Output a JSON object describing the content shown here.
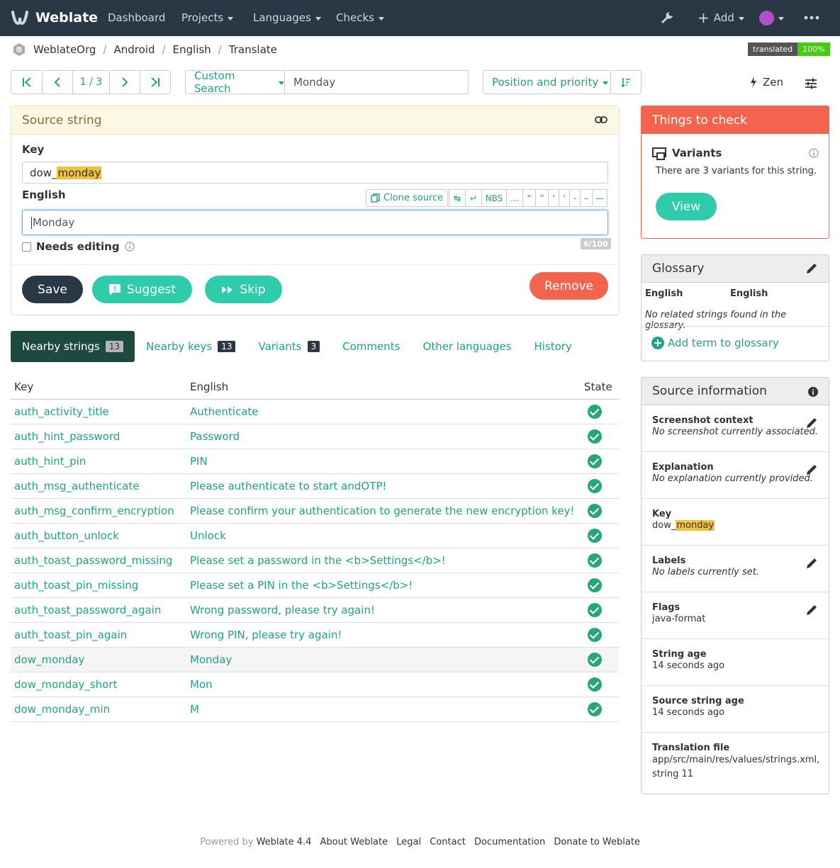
{
  "navbar": {
    "brand": "Weblate",
    "items": [
      "Dashboard",
      "Projects",
      "Languages",
      "Checks"
    ],
    "add_label": "Add",
    "bg_color": "#2a3744"
  },
  "breadcrumb": [
    "WeblateOrg",
    "Android",
    "English",
    "Translate"
  ],
  "status_badge": {
    "label": "translated",
    "value": "100%"
  },
  "pager": {
    "position": "1 / 3"
  },
  "search": {
    "mode": "Custom Search",
    "query": "Monday"
  },
  "sort": {
    "label": "Position and priority"
  },
  "zen_label": "Zen",
  "source_panel": {
    "title": "Source string",
    "key_label": "Key",
    "key_prefix": "dow_",
    "key_highlight": "monday",
    "lang_label": "English",
    "clone_label": "Clone source",
    "special_chars": [
      "↹",
      "↵",
      "NBS",
      "…",
      "“",
      "”",
      "‘",
      "’",
      "-",
      "–",
      "—"
    ],
    "text": "Monday",
    "needs_editing": "Needs editing",
    "counter": "6/100",
    "buttons": {
      "save": "Save",
      "suggest": "Suggest",
      "skip": "Skip",
      "remove": "Remove"
    }
  },
  "tabs": [
    {
      "label": "Nearby strings",
      "count": "13"
    },
    {
      "label": "Nearby keys",
      "count": "13"
    },
    {
      "label": "Variants",
      "count": "3"
    },
    {
      "label": "Comments",
      "count": ""
    },
    {
      "label": "Other languages",
      "count": ""
    },
    {
      "label": "History",
      "count": ""
    }
  ],
  "table": {
    "headers": [
      "Key",
      "English",
      "State"
    ],
    "rows": [
      {
        "key": "auth_activity_title",
        "text": "Authenticate"
      },
      {
        "key": "auth_hint_password",
        "text": "Password"
      },
      {
        "key": "auth_hint_pin",
        "text": "PIN"
      },
      {
        "key": "auth_msg_authenticate",
        "text": "Please authenticate to start andOTP!"
      },
      {
        "key": "auth_msg_confirm_encryption",
        "text": "Please confirm your authentication to generate the new encryption key!"
      },
      {
        "key": "auth_button_unlock",
        "text": "Unlock"
      },
      {
        "key": "auth_toast_password_missing",
        "text": "Please set a password in the <b>Settings</b>!"
      },
      {
        "key": "auth_toast_pin_missing",
        "text": "Please set a PIN in the <b>Settings</b>!"
      },
      {
        "key": "auth_toast_password_again",
        "text": "Wrong password, please try again!"
      },
      {
        "key": "auth_toast_pin_again",
        "text": "Wrong PIN, please try again!"
      },
      {
        "key": "dow_monday",
        "text": "Monday"
      },
      {
        "key": "dow_monday_short",
        "text": "Mon"
      },
      {
        "key": "dow_monday_min",
        "text": "M"
      }
    ]
  },
  "checks": {
    "title": "Things to check",
    "name": "Variants",
    "desc": "There are 3 variants for this string.",
    "view": "View"
  },
  "glossary": {
    "title": "Glossary",
    "col1": "English",
    "col2": "English",
    "empty": "No related strings found in the glossary.",
    "add": "Add term to glossary"
  },
  "source_info": {
    "title": "Source information",
    "screenshot_t": "Screenshot context",
    "screenshot_v": "No screenshot currently associated.",
    "explanation_t": "Explanation",
    "explanation_v": "No explanation currently provided.",
    "key_t": "Key",
    "key_prefix": "dow_",
    "key_highlight": "monday",
    "labels_t": "Labels",
    "labels_v": "No labels currently set.",
    "flags_t": "Flags",
    "flags_v": "java-format",
    "age_t": "String age",
    "age_v": "14 seconds ago",
    "src_age_t": "Source string age",
    "src_age_v": "14 seconds ago",
    "file_t": "Translation file",
    "file_v1": "app/src/main/res/values/strings.xml,",
    "file_v2": "string 11"
  },
  "footer": {
    "powered": "Powered by",
    "version": "Weblate 4.4",
    "links": [
      "About Weblate",
      "Legal",
      "Contact",
      "Documentation",
      "Donate to Weblate"
    ]
  }
}
